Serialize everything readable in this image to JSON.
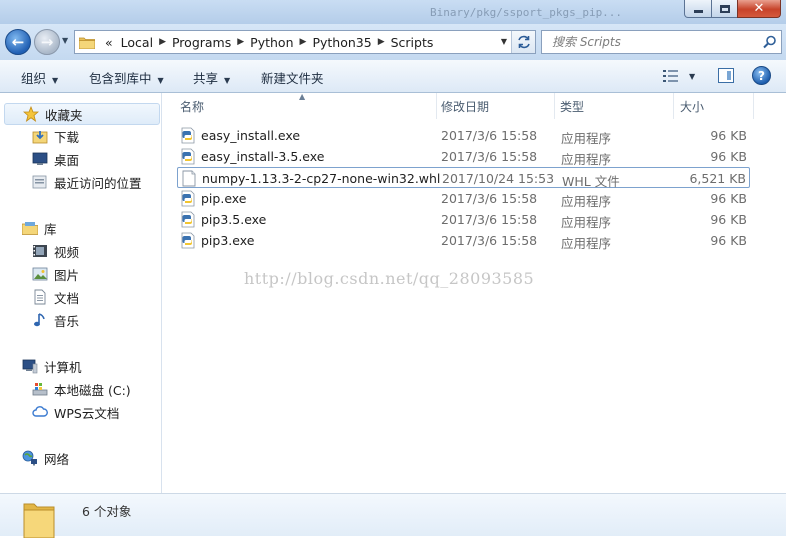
{
  "title_bar": {
    "background_text": "Binary/pkg/ssport_pkgs_pip..."
  },
  "address": {
    "overflow": "«",
    "crumbs": [
      "Local",
      "Programs",
      "Python",
      "Python35",
      "Scripts"
    ]
  },
  "search": {
    "placeholder": "搜索 Scripts"
  },
  "commands": {
    "organize": "组织",
    "include_in_library": "包含到库中",
    "share": "共享",
    "new_folder": "新建文件夹"
  },
  "nav": {
    "favorites": "收藏夹",
    "downloads": "下载",
    "desktop": "桌面",
    "recent": "最近访问的位置",
    "libraries": "库",
    "videos": "视频",
    "pictures": "图片",
    "documents": "文档",
    "music": "音乐",
    "computer": "计算机",
    "local_disk": "本地磁盘 (C:)",
    "wps_cloud": "WPS云文档",
    "network": "网络"
  },
  "columns": {
    "name": "名称",
    "date": "修改日期",
    "type": "类型",
    "size": "大小"
  },
  "files": [
    {
      "name": "easy_install.exe",
      "date": "2017/3/6 15:58",
      "type": "应用程序",
      "size": "96 KB",
      "icon": "python-exe-icon"
    },
    {
      "name": "easy_install-3.5.exe",
      "date": "2017/3/6 15:58",
      "type": "应用程序",
      "size": "96 KB",
      "icon": "python-exe-icon"
    },
    {
      "name": "numpy-1.13.3-2-cp27-none-win32.whl",
      "date": "2017/10/24 15:53",
      "type": "WHL 文件",
      "size": "6,521 KB",
      "icon": "blank-file-icon"
    },
    {
      "name": "pip.exe",
      "date": "2017/3/6 15:58",
      "type": "应用程序",
      "size": "96 KB",
      "icon": "python-exe-icon"
    },
    {
      "name": "pip3.5.exe",
      "date": "2017/3/6 15:58",
      "type": "应用程序",
      "size": "96 KB",
      "icon": "python-exe-icon"
    },
    {
      "name": "pip3.exe",
      "date": "2017/3/6 15:58",
      "type": "应用程序",
      "size": "96 KB",
      "icon": "python-exe-icon"
    }
  ],
  "watermark": "http://blog.csdn.net/qq_28093585",
  "status": {
    "item_count": "6 个对象"
  },
  "colors": {
    "accent": "#3b6ea5",
    "selection_border": "#7da2ce",
    "header_gradient_top": "#f5f9fd"
  }
}
